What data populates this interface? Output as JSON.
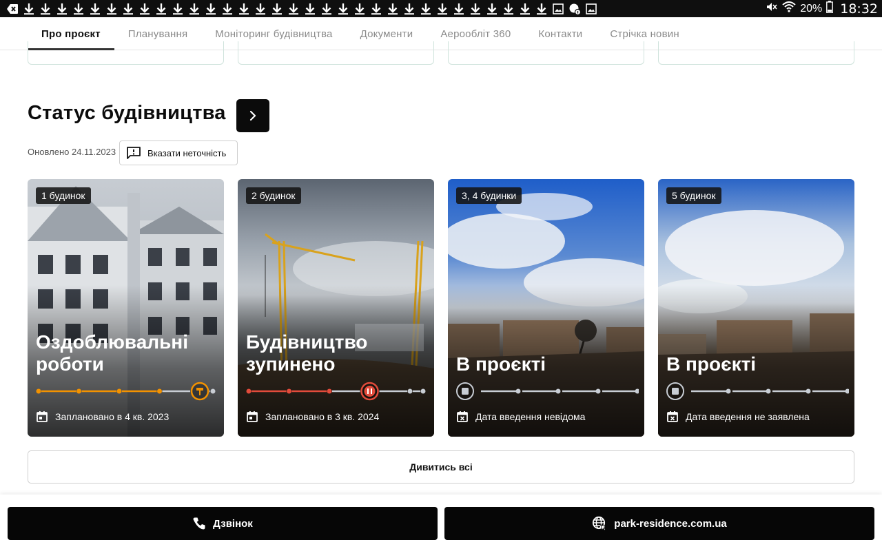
{
  "status_bar": {
    "battery_percent": "20%",
    "time": "18:32",
    "download_icon_count": 33
  },
  "tabs": [
    {
      "label": "Про проєкт",
      "active": true
    },
    {
      "label": "Планування",
      "active": false
    },
    {
      "label": "Моніторинг будівництва",
      "active": false
    },
    {
      "label": "Документи",
      "active": false
    },
    {
      "label": "Аерооблiт 360",
      "active": false
    },
    {
      "label": "Контакти",
      "active": false
    },
    {
      "label": "Стрічка новин",
      "active": false
    }
  ],
  "section": {
    "title": "Статус будівництва",
    "updated": "Оновлено 24.11.2023",
    "report_label": "Вказати неточність"
  },
  "cards": [
    {
      "badge": "1 будинок",
      "title": "Оздоблювальні роботи",
      "schedule": "Заплановано в 4 кв. 2023",
      "progress_step": 4,
      "state": "active",
      "color": "#f39200"
    },
    {
      "badge": "2 будинок",
      "title": "Будівництво зупинено",
      "schedule": "Заплановано в 3 кв. 2024",
      "progress_step": 3,
      "state": "paused",
      "color": "#e24b3b"
    },
    {
      "badge": "3, 4 будинки",
      "title": "В проєкті",
      "schedule": "Дата введення невідома",
      "progress_step": 0,
      "state": "project",
      "color": "#c8cdd4"
    },
    {
      "badge": "5 будинок",
      "title": "В проєкті",
      "schedule": "Дата введення не заявлена",
      "progress_step": 0,
      "state": "project",
      "color": "#c8cdd4"
    }
  ],
  "see_all_label": "Дивитись всі",
  "actions": {
    "call_label": "Дзвінок",
    "website_label": "park-residence.com.ua"
  },
  "colors": {
    "accent_orange": "#f39200",
    "accent_red": "#e24b3b",
    "inactive_grey": "#c8cdd4",
    "primary_black": "#0b0b0b"
  }
}
